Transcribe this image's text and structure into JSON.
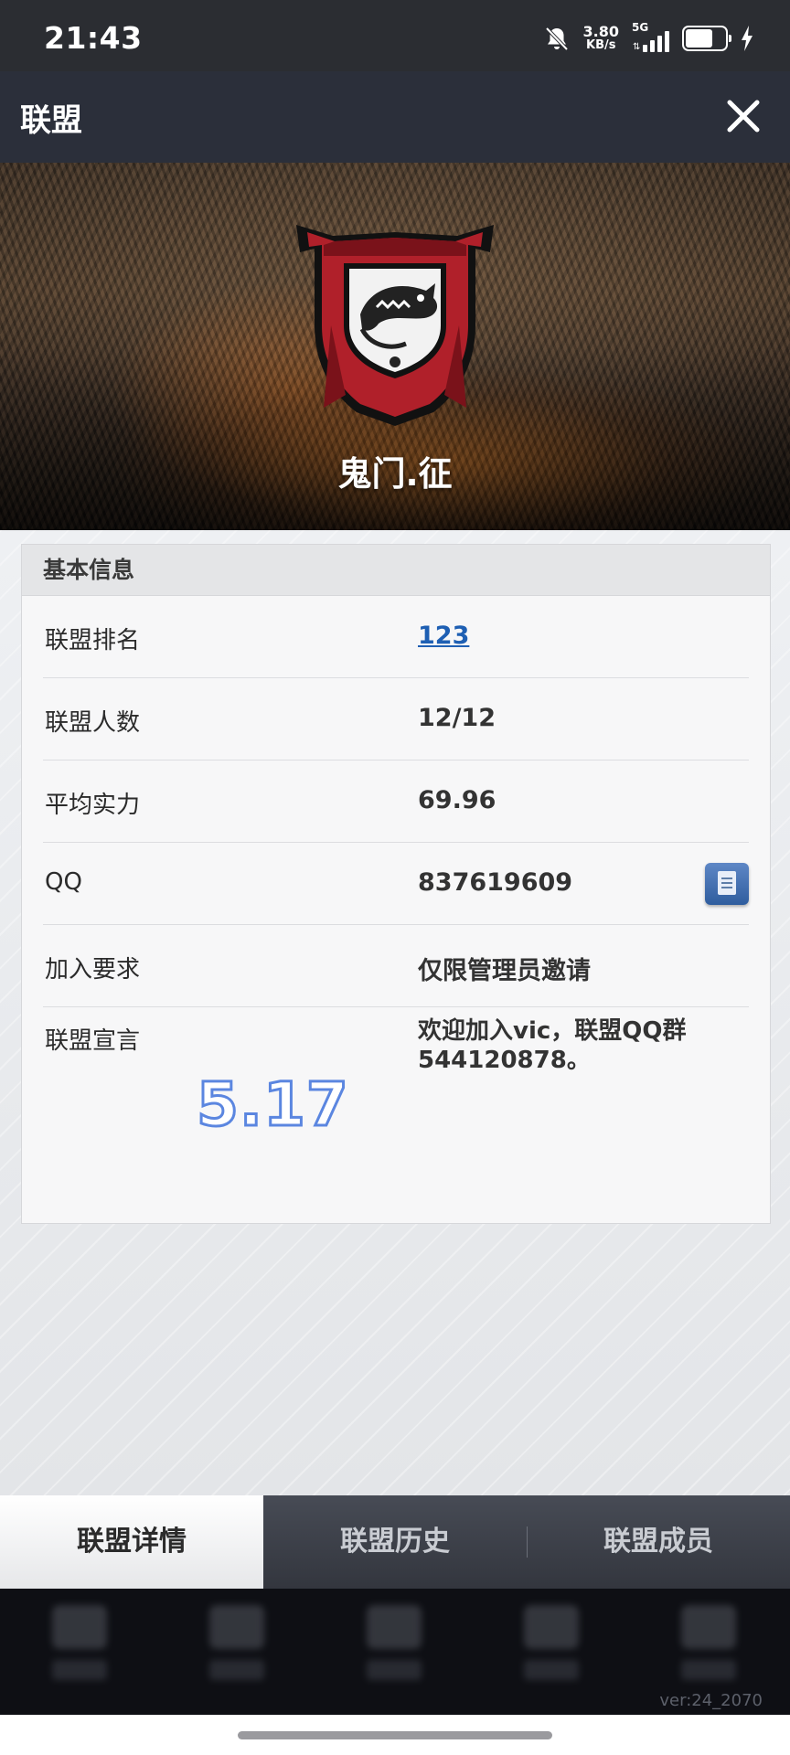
{
  "status_bar": {
    "time": "21:43",
    "net_speed_value": "3.80",
    "net_speed_unit": "KB/s",
    "network_type": "5G",
    "icons": [
      "bell-off-icon",
      "signal-icon",
      "battery-icon",
      "charging-icon"
    ]
  },
  "header": {
    "title": "联盟",
    "close_icon": "close-icon"
  },
  "banner": {
    "alliance_name": "鬼门.征",
    "logo": "shark-banner-logo"
  },
  "basic_info": {
    "section_title": "基本信息",
    "rows": [
      {
        "label": "联盟排名",
        "value": "123"
      },
      {
        "label": "联盟人数",
        "value": "12/12"
      },
      {
        "label": "平均实力",
        "value": "69.96"
      },
      {
        "label": "QQ",
        "value": "837619609"
      },
      {
        "label": "加入要求",
        "value": "仅限管理员邀请"
      }
    ],
    "declaration_label": "联盟宣言",
    "declaration_value": "欢迎加入vic，联盟QQ群544120878。"
  },
  "watermark": "5.17",
  "tabs": [
    {
      "label": "联盟详情",
      "active": true
    },
    {
      "label": "联盟历史",
      "active": false
    },
    {
      "label": "联盟成员",
      "active": false
    }
  ],
  "version": "ver:24_2070",
  "colors": {
    "link": "#1e5fb3",
    "logo_red": "#b0202a",
    "watermark_outline": "#5b86e0"
  }
}
